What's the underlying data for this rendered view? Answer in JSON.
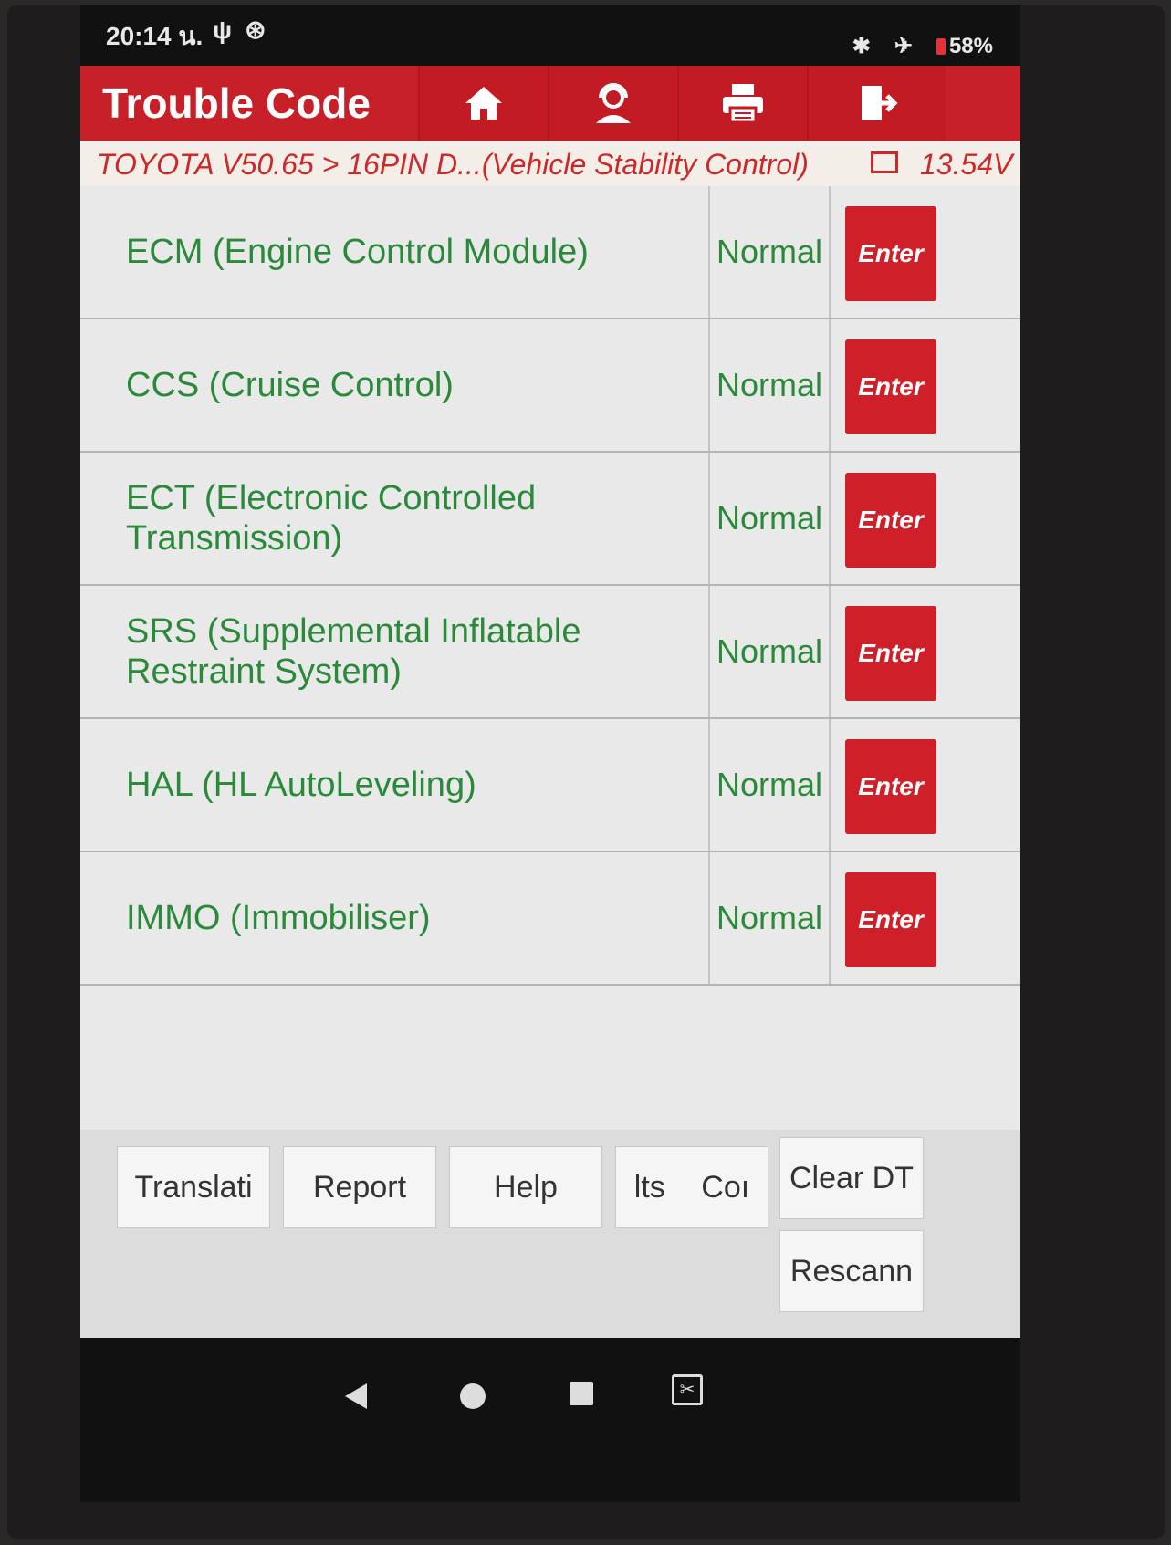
{
  "status_bar": {
    "time": "20:14 น.",
    "battery": "58%"
  },
  "header": {
    "title": "Trouble Code",
    "nav": [
      {
        "icon": "home-icon"
      },
      {
        "icon": "support-icon"
      },
      {
        "icon": "print-icon"
      },
      {
        "icon": "exit-icon"
      }
    ]
  },
  "breadcrumb": {
    "path": "TOYOTA V50.65 > 16PIN D...(Vehicle Stability Control)",
    "voltage": "13.54V"
  },
  "systems": [
    {
      "name": "ECM (Engine Control Module)",
      "status": "Normal",
      "action": "Enter"
    },
    {
      "name": "CCS (Cruise Control)",
      "status": "Normal",
      "action": "Enter"
    },
    {
      "name": "ECT (Electronic Controlled Transmission)",
      "status": "Normal",
      "action": "Enter"
    },
    {
      "name": "SRS (Supplemental Inflatable Restraint System)",
      "status": "Normal",
      "action": "Enter"
    },
    {
      "name": "HAL (HL AutoLeveling)",
      "status": "Normal",
      "action": "Enter"
    },
    {
      "name": "IMMO (Immobiliser)",
      "status": "Normal",
      "action": "Enter"
    }
  ],
  "bottom_buttons": {
    "translation": "Translati",
    "report": "Report",
    "help": "Help",
    "results": "lts",
    "compare": "Coı",
    "clear_dtc": "Clear DT",
    "rescan": "Rescann"
  },
  "colors": {
    "header_red": "#c82028",
    "status_green": "#2a8a3a",
    "enter_red": "#cf1f28"
  }
}
